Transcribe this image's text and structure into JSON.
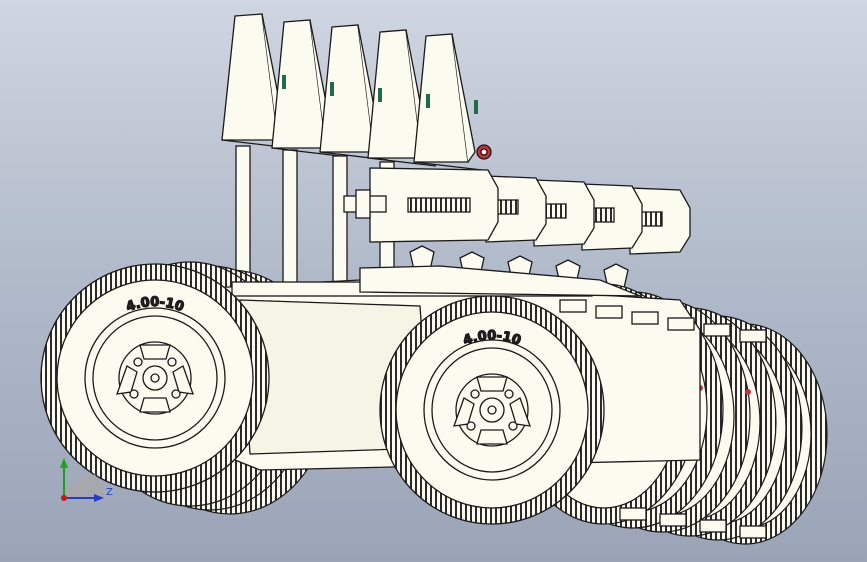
{
  "model": {
    "left_tire_label": "4.00-10",
    "right_tire_label": "4.00-10"
  },
  "triad": {
    "z_label": "Z"
  },
  "colors": {
    "background_top": "#cfd6e2",
    "background_bottom": "#9aa4b6",
    "part_fill": "#fbfbf0",
    "edge": "#1a1a1a",
    "accent_red": "#c8303c",
    "accent_green": "#1f6b4a",
    "axis_x": "#d21414",
    "axis_y": "#16a516",
    "axis_z": "#1f3fd0"
  },
  "icons": [
    "triad-icon"
  ]
}
